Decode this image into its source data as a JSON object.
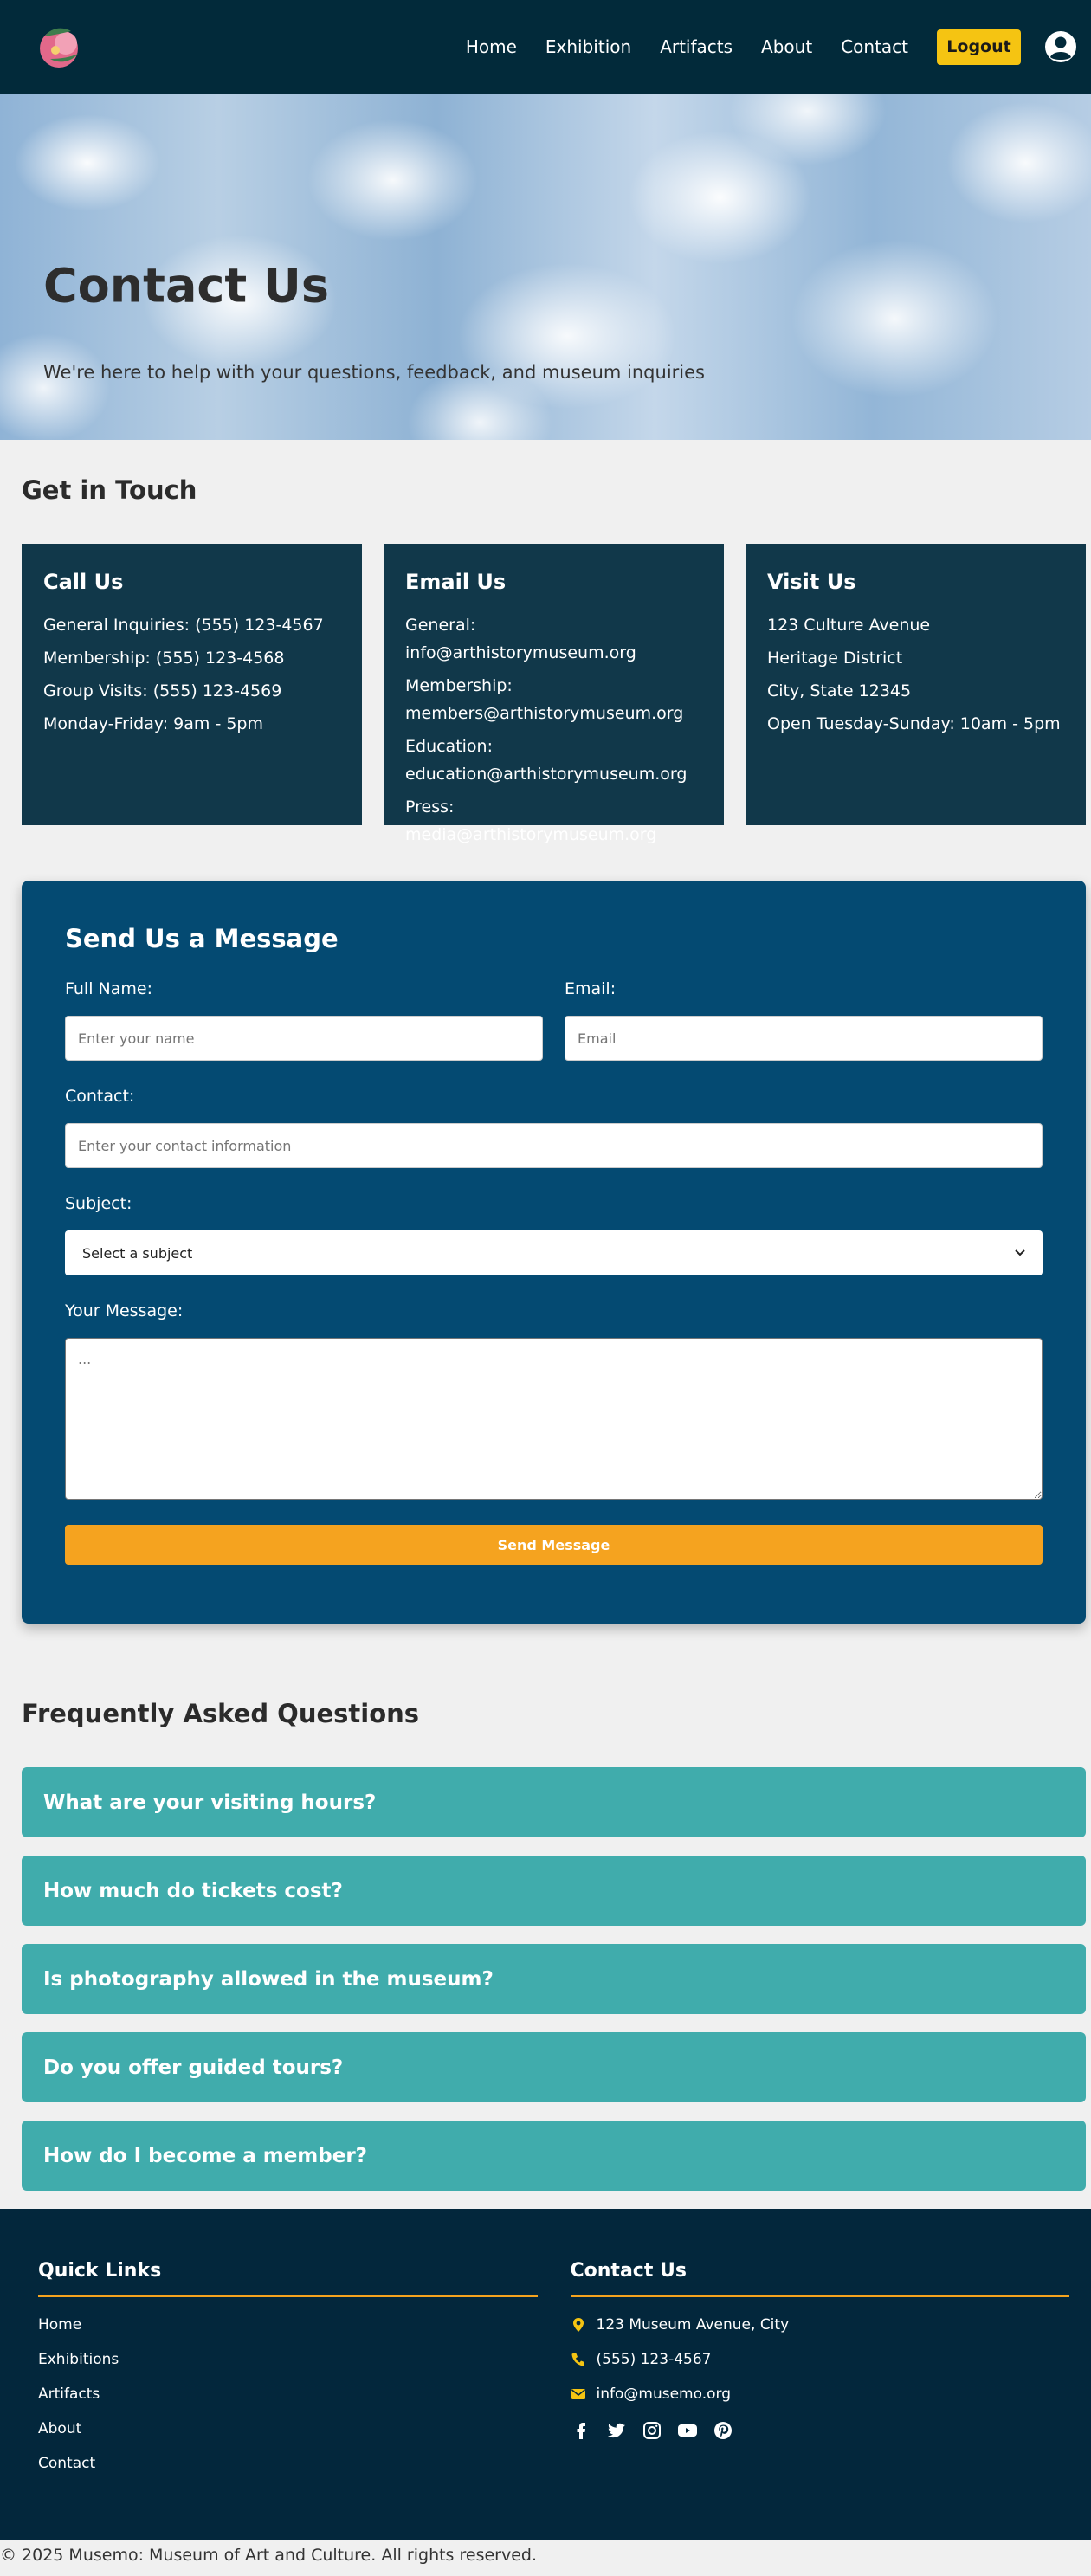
{
  "nav": {
    "links": [
      "Home",
      "Exhibition",
      "Artifacts",
      "About",
      "Contact"
    ],
    "logout_label": "Logout"
  },
  "hero": {
    "title": "Contact Us",
    "subtitle": "We're here to help with your questions, feedback, and museum inquiries"
  },
  "contact_section": {
    "title": "Get in Touch",
    "cards": [
      {
        "title": "Call Us",
        "lines": [
          "General Inquiries: (555) 123-4567",
          "Membership: (555) 123-4568",
          "Group Visits: (555) 123-4569",
          "Monday-Friday: 9am - 5pm"
        ]
      },
      {
        "title": "Email Us",
        "lines": [
          "General: info@arthistorymuseum.org",
          "Membership: members@arthistorymuseum.org",
          "Education: education@arthistorymuseum.org",
          "Press: media@arthistorymuseum.org"
        ]
      },
      {
        "title": "Visit Us",
        "lines": [
          "123 Culture Avenue",
          "Heritage District",
          "City, State 12345",
          "Open Tuesday-Sunday: 10am - 5pm"
        ]
      }
    ]
  },
  "form": {
    "title": "Send Us a Message",
    "full_name_label": "Full Name:",
    "full_name_placeholder": "Enter your name",
    "email_label": "Email:",
    "email_placeholder": "Email",
    "contact_label": "Contact:",
    "contact_placeholder": "Enter your contact information",
    "subject_label": "Subject:",
    "subject_selected": "Select a subject",
    "message_label": "Your Message:",
    "message_placeholder": "...",
    "send_label": "Send Message"
  },
  "faq": {
    "title": "Frequently Asked Questions",
    "questions": [
      "What are your visiting hours?",
      "How much do tickets cost?",
      "Is photography allowed in the museum?",
      "Do you offer guided tours?",
      "How do I become a member?"
    ]
  },
  "footer": {
    "quick_links_title": "Quick Links",
    "quick_links": [
      "Home",
      "Exhibitions",
      "Artifacts",
      "About",
      "Contact"
    ],
    "contact_title": "Contact Us",
    "address": "123 Museum Avenue, City",
    "phone": "(555) 123-4567",
    "email": "info@musemo.org",
    "social_icons": [
      "facebook-icon",
      "twitter-icon",
      "instagram-icon",
      "youtube-icon",
      "pinterest-icon"
    ]
  },
  "copyright": "© 2025 Musemo: Museum of Art and Culture. All rights reserved.",
  "colors": {
    "nav_bg": "#022a3a",
    "card_bg": "#11384a",
    "form_bg": "#044a72",
    "accent_orange": "#f5a31f",
    "logout_yellow": "#f5c412",
    "faq_teal": "#40acac",
    "footer_bg": "#03273c"
  }
}
